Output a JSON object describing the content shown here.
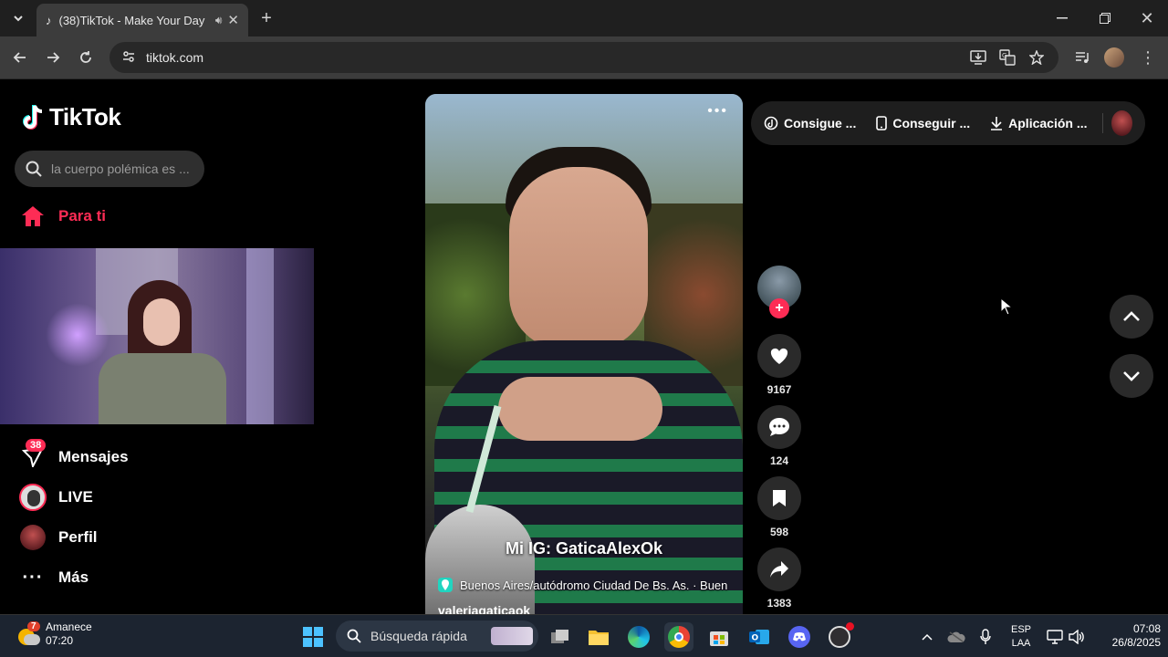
{
  "browser": {
    "tab_title": "(38)TikTok - Make Your Day",
    "url": "tiktok.com"
  },
  "tiktok": {
    "logo_text": "TikTok",
    "search_placeholder": "la cuerpo polémica es ...",
    "nav": {
      "for_you": "Para ti",
      "messages": "Mensajes",
      "messages_badge": "38",
      "live": "LIVE",
      "profile": "Perfil",
      "more": "Más"
    },
    "topbar": {
      "coins": "Consigue ...",
      "get_app": "Conseguir ...",
      "download": "Aplicación ..."
    },
    "video": {
      "caption": "Mi IG: GaticaAlexOk",
      "location": "Buenos Aires/autódromo Ciudad De Bs. As. · Buen",
      "username": "valeriagaticaok"
    },
    "actions": {
      "likes": "9167",
      "comments": "124",
      "saves": "598",
      "shares": "1383"
    }
  },
  "taskbar": {
    "weather_text": "Amanece",
    "weather_time": "07:20",
    "weather_badge": "7",
    "search_label": "Búsqueda rápida",
    "lang_top": "ESP",
    "lang_bottom": "LAA",
    "clock_time": "07:08",
    "clock_date": "26/8/2025"
  },
  "colors": {
    "accent": "#fe2c55",
    "page_bg": "#000000",
    "taskbar_bg": "#1c2430"
  }
}
